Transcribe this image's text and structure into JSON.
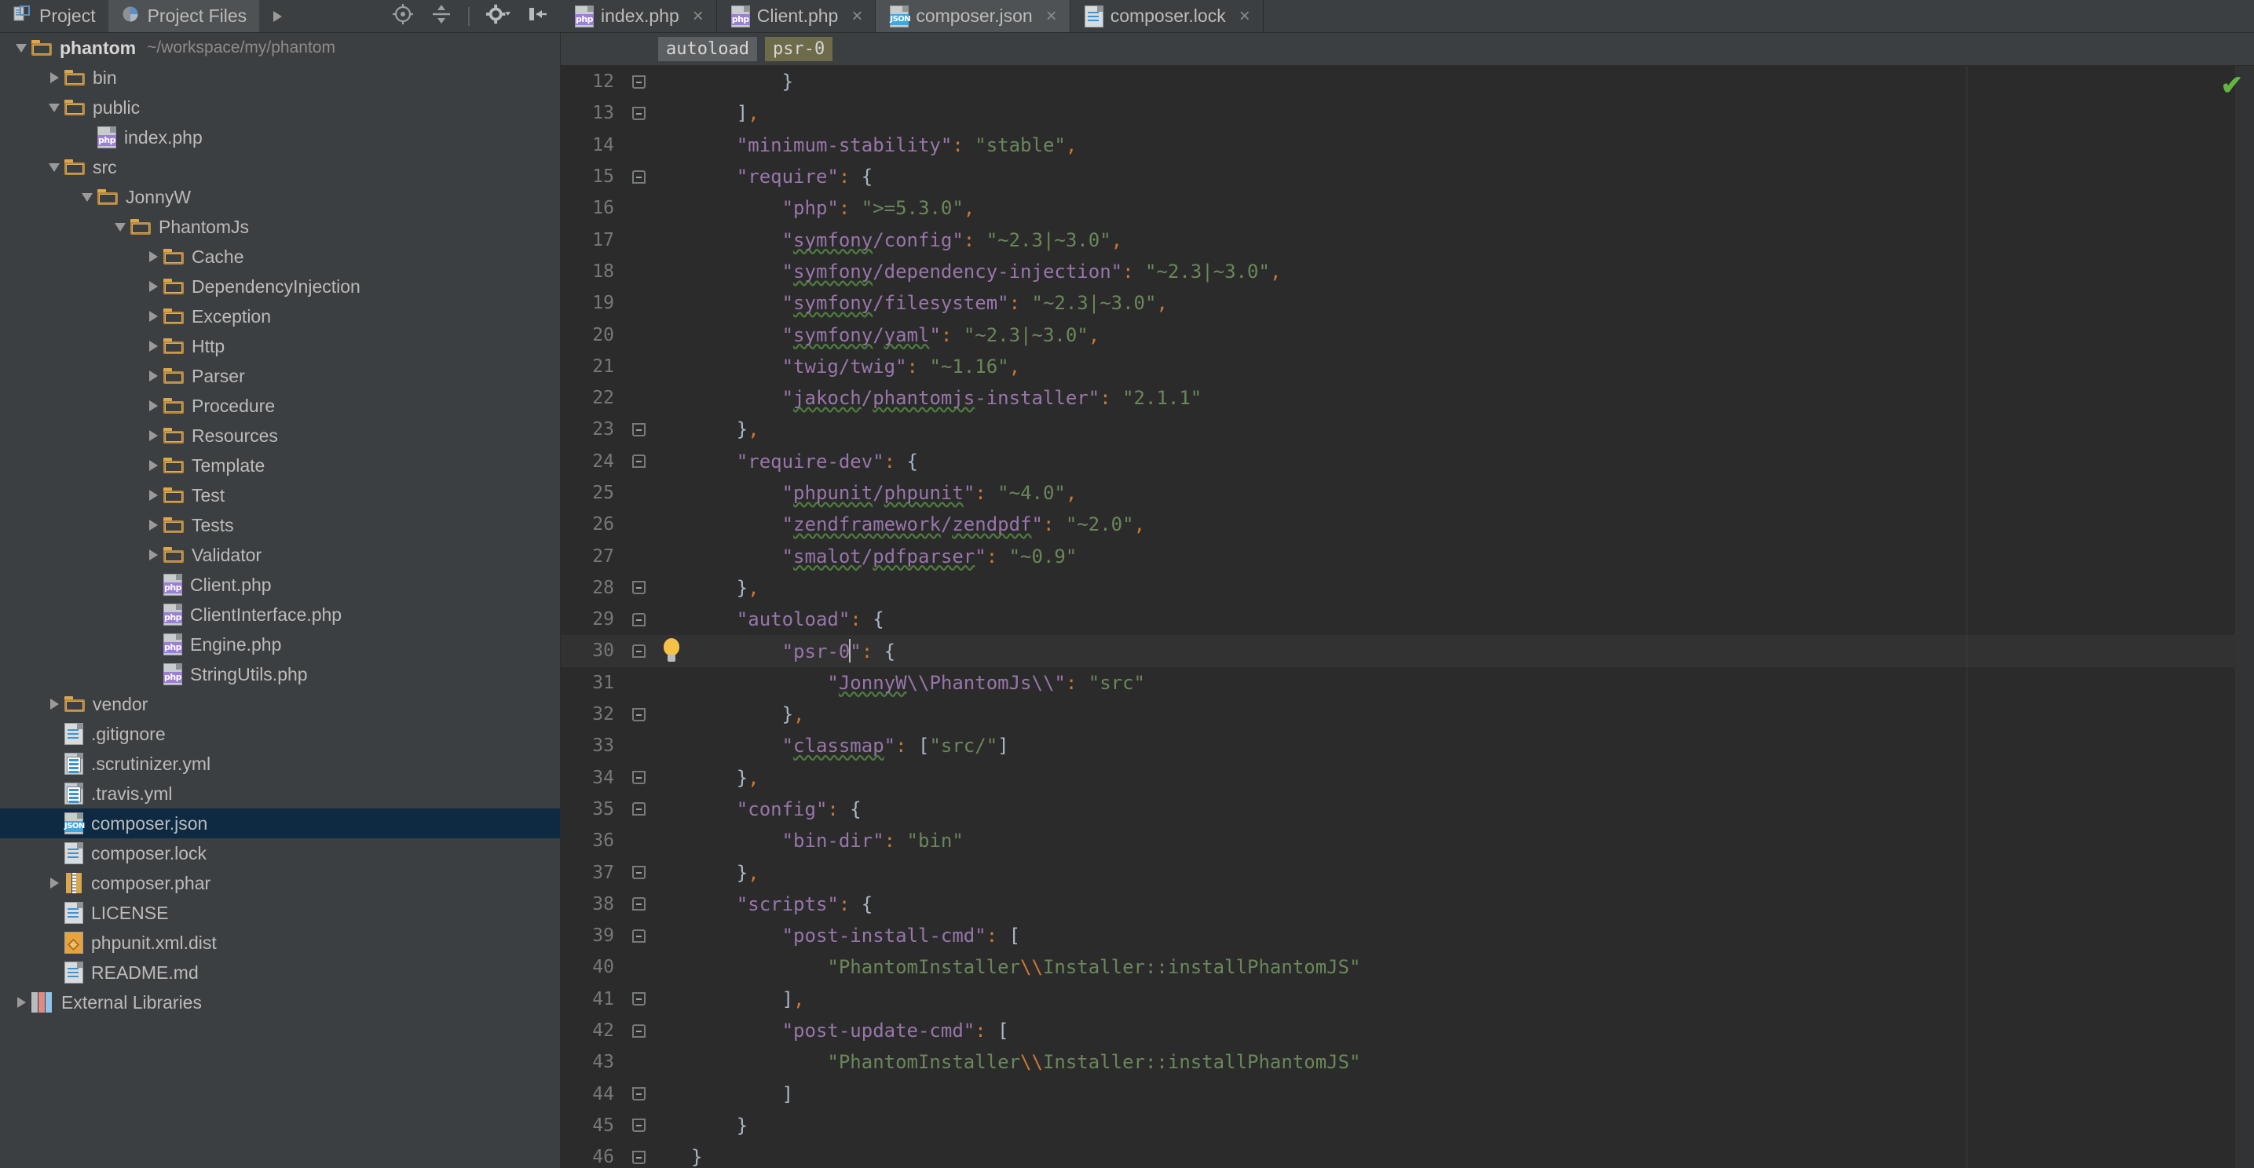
{
  "project_toolbar": {
    "tabs": [
      {
        "label": "Project",
        "icon": "project-icon",
        "selected": false
      },
      {
        "label": "Project Files",
        "icon": "project-files-icon",
        "selected": true
      }
    ],
    "expand_arrow_icon": "chevron-right-icon",
    "icons": [
      {
        "name": "locate-target-icon",
        "glyph": "⊕"
      },
      {
        "name": "collapse-all-icon",
        "glyph": "⫫"
      },
      {
        "name": "settings-gear-icon",
        "glyph": "⚙"
      },
      {
        "name": "hide-panel-icon",
        "glyph": "⇤"
      }
    ]
  },
  "editor_tabs": [
    {
      "label": "index.php",
      "filetype": "php",
      "active": false,
      "close": "×"
    },
    {
      "label": "Client.php",
      "filetype": "php",
      "active": false,
      "close": "×"
    },
    {
      "label": "composer.json",
      "filetype": "json",
      "active": true,
      "close": "×"
    },
    {
      "label": "composer.lock",
      "filetype": "txt",
      "active": false,
      "close": "×"
    }
  ],
  "breadcrumbs": [
    {
      "label": "autoload",
      "style": "c1"
    },
    {
      "label": "psr-0",
      "style": "c2"
    }
  ],
  "tree": [
    {
      "indent": 0,
      "twisty": "down",
      "icon": "folder",
      "name": "phantom",
      "bold": true,
      "path": "~/workspace/my/phantom"
    },
    {
      "indent": 1,
      "twisty": "right",
      "icon": "folder",
      "name": "bin"
    },
    {
      "indent": 1,
      "twisty": "down",
      "icon": "folder",
      "name": "public"
    },
    {
      "indent": 2,
      "twisty": "none",
      "icon": "php",
      "name": "index.php"
    },
    {
      "indent": 1,
      "twisty": "down",
      "icon": "folder",
      "name": "src"
    },
    {
      "indent": 2,
      "twisty": "down",
      "icon": "folder",
      "name": "JonnyW"
    },
    {
      "indent": 3,
      "twisty": "down",
      "icon": "folder",
      "name": "PhantomJs"
    },
    {
      "indent": 4,
      "twisty": "right",
      "icon": "folder",
      "name": "Cache"
    },
    {
      "indent": 4,
      "twisty": "right",
      "icon": "folder",
      "name": "DependencyInjection"
    },
    {
      "indent": 4,
      "twisty": "right",
      "icon": "folder",
      "name": "Exception"
    },
    {
      "indent": 4,
      "twisty": "right",
      "icon": "folder",
      "name": "Http"
    },
    {
      "indent": 4,
      "twisty": "right",
      "icon": "folder",
      "name": "Parser"
    },
    {
      "indent": 4,
      "twisty": "right",
      "icon": "folder",
      "name": "Procedure"
    },
    {
      "indent": 4,
      "twisty": "right",
      "icon": "folder",
      "name": "Resources"
    },
    {
      "indent": 4,
      "twisty": "right",
      "icon": "folder",
      "name": "Template"
    },
    {
      "indent": 4,
      "twisty": "right",
      "icon": "folder",
      "name": "Test"
    },
    {
      "indent": 4,
      "twisty": "right",
      "icon": "folder",
      "name": "Tests"
    },
    {
      "indent": 4,
      "twisty": "right",
      "icon": "folder",
      "name": "Validator"
    },
    {
      "indent": 4,
      "twisty": "none",
      "icon": "php",
      "name": "Client.php"
    },
    {
      "indent": 4,
      "twisty": "none",
      "icon": "php",
      "name": "ClientInterface.php"
    },
    {
      "indent": 4,
      "twisty": "none",
      "icon": "php",
      "name": "Engine.php"
    },
    {
      "indent": 4,
      "twisty": "none",
      "icon": "php",
      "name": "StringUtils.php"
    },
    {
      "indent": 1,
      "twisty": "right",
      "icon": "folder",
      "name": "vendor"
    },
    {
      "indent": 1,
      "twisty": "none",
      "icon": "txt",
      "name": ".gitignore"
    },
    {
      "indent": 1,
      "twisty": "none",
      "icon": "yml",
      "name": ".scrutinizer.yml"
    },
    {
      "indent": 1,
      "twisty": "none",
      "icon": "yml",
      "name": ".travis.yml"
    },
    {
      "indent": 1,
      "twisty": "none",
      "icon": "json",
      "name": "composer.json",
      "selected": true
    },
    {
      "indent": 1,
      "twisty": "none",
      "icon": "txt",
      "name": "composer.lock"
    },
    {
      "indent": 1,
      "twisty": "right",
      "icon": "phar",
      "name": "composer.phar"
    },
    {
      "indent": 1,
      "twisty": "none",
      "icon": "txt",
      "name": "LICENSE"
    },
    {
      "indent": 1,
      "twisty": "none",
      "icon": "xml",
      "name": "phpunit.xml.dist"
    },
    {
      "indent": 1,
      "twisty": "none",
      "icon": "txt",
      "name": "README.md"
    },
    {
      "indent": 0,
      "twisty": "right",
      "icon": "extlib",
      "name": "External Libraries"
    }
  ],
  "code": {
    "first_line": 12,
    "current_line": 30,
    "bulb_line": 30,
    "status_icon": "inspection-ok-checkmark",
    "lines": [
      {
        "n": 12,
        "fold": "close",
        "html": "        <span class=\"b\">}</span>"
      },
      {
        "n": 13,
        "fold": "close",
        "html": "    <span class=\"b\">]</span><span class=\"p\">,</span>"
      },
      {
        "n": 14,
        "fold": "none",
        "html": "    <span class=\"k\">\"minimum-stability\"</span><span class=\"p\">:</span> <span class=\"s\">\"stable\"</span><span class=\"p\">,</span>"
      },
      {
        "n": 15,
        "fold": "open",
        "html": "    <span class=\"k\">\"require\"</span><span class=\"p\">:</span> <span class=\"b\">{</span>"
      },
      {
        "n": 16,
        "fold": "none",
        "html": "        <span class=\"k\">\"php\"</span><span class=\"p\">:</span> <span class=\"s\">\"&gt;=5.3.0\"</span><span class=\"p\">,</span>"
      },
      {
        "n": 17,
        "fold": "none",
        "html": "        <span class=\"k\">\"<span class=\"sp\">symfony</span>/config\"</span><span class=\"p\">:</span> <span class=\"s\">\"~2.3|~3.0\"</span><span class=\"p\">,</span>"
      },
      {
        "n": 18,
        "fold": "none",
        "html": "        <span class=\"k\">\"<span class=\"sp\">symfony</span>/dependency-injection\"</span><span class=\"p\">:</span> <span class=\"s\">\"~2.3|~3.0\"</span><span class=\"p\">,</span>"
      },
      {
        "n": 19,
        "fold": "none",
        "html": "        <span class=\"k\">\"<span class=\"sp\">symfony</span>/filesystem\"</span><span class=\"p\">:</span> <span class=\"s\">\"~2.3|~3.0\"</span><span class=\"p\">,</span>"
      },
      {
        "n": 20,
        "fold": "none",
        "html": "        <span class=\"k\">\"<span class=\"sp\">symfony</span>/<span class=\"sp\">yaml</span>\"</span><span class=\"p\">:</span> <span class=\"s\">\"~2.3|~3.0\"</span><span class=\"p\">,</span>"
      },
      {
        "n": 21,
        "fold": "none",
        "html": "        <span class=\"k\">\"twig/twig\"</span><span class=\"p\">:</span> <span class=\"s\">\"~1.16\"</span><span class=\"p\">,</span>"
      },
      {
        "n": 22,
        "fold": "none",
        "html": "        <span class=\"k\">\"<span class=\"sp\">jakoch</span>/<span class=\"sp\">phantomjs</span>-installer\"</span><span class=\"p\">:</span> <span class=\"s\">\"2.1.1\"</span>"
      },
      {
        "n": 23,
        "fold": "close",
        "html": "    <span class=\"b\">}</span><span class=\"p\">,</span>"
      },
      {
        "n": 24,
        "fold": "open",
        "html": "    <span class=\"k\">\"require-dev\"</span><span class=\"p\">:</span> <span class=\"b\">{</span>"
      },
      {
        "n": 25,
        "fold": "none",
        "html": "        <span class=\"k\">\"<span class=\"sp\">phpunit</span>/<span class=\"sp\">phpunit</span>\"</span><span class=\"p\">:</span> <span class=\"s\">\"~4.0\"</span><span class=\"p\">,</span>"
      },
      {
        "n": 26,
        "fold": "none",
        "html": "        <span class=\"k\">\"<span class=\"sp\">zendframework</span>/<span class=\"sp\">zendpdf</span>\"</span><span class=\"p\">:</span> <span class=\"s\">\"~2.0\"</span><span class=\"p\">,</span>"
      },
      {
        "n": 27,
        "fold": "none",
        "html": "        <span class=\"k\">\"<span class=\"sp\">smalot</span>/<span class=\"sp\">pdfparser</span>\"</span><span class=\"p\">:</span> <span class=\"s\">\"~0.9\"</span>"
      },
      {
        "n": 28,
        "fold": "close",
        "html": "    <span class=\"b\">}</span><span class=\"p\">,</span>"
      },
      {
        "n": 29,
        "fold": "open",
        "html": "    <span class=\"k\">\"autoload\"</span><span class=\"p\">:</span> <span class=\"b\">{</span>"
      },
      {
        "n": 30,
        "fold": "open",
        "bulb": true,
        "current": true,
        "html": "        <span class=\"k\">\"psr-0</span><span class=\"caret\"></span><span class=\"k\">\"</span><span class=\"p\">:</span> <span class=\"b\">{</span>"
      },
      {
        "n": 31,
        "fold": "none",
        "html": "            <span class=\"k\">\"<span class=\"sp\">JonnyW</span>\\\\PhantomJs\\\\\"</span><span class=\"p\">:</span> <span class=\"s\">\"src\"</span>"
      },
      {
        "n": 32,
        "fold": "close",
        "html": "        <span class=\"b\">}</span><span class=\"p\">,</span>"
      },
      {
        "n": 33,
        "fold": "none",
        "html": "        <span class=\"k\">\"<span class=\"sp\">classmap</span>\"</span><span class=\"p\">:</span> <span class=\"b\">[</span><span class=\"s\">\"src/\"</span><span class=\"b\">]</span>"
      },
      {
        "n": 34,
        "fold": "close",
        "html": "    <span class=\"b\">}</span><span class=\"p\">,</span>"
      },
      {
        "n": 35,
        "fold": "open",
        "html": "    <span class=\"k\">\"config\"</span><span class=\"p\">:</span> <span class=\"b\">{</span>"
      },
      {
        "n": 36,
        "fold": "none",
        "html": "        <span class=\"k\">\"bin-dir\"</span><span class=\"p\">:</span> <span class=\"s\">\"bin\"</span>"
      },
      {
        "n": 37,
        "fold": "close",
        "html": "    <span class=\"b\">}</span><span class=\"p\">,</span>"
      },
      {
        "n": 38,
        "fold": "open",
        "html": "    <span class=\"k\">\"scripts\"</span><span class=\"p\">:</span> <span class=\"b\">{</span>"
      },
      {
        "n": 39,
        "fold": "open",
        "html": "        <span class=\"k\">\"post-install-cmd\"</span><span class=\"p\">:</span> <span class=\"b\">[</span>"
      },
      {
        "n": 40,
        "fold": "none",
        "html": "            <span class=\"s\">\"PhantomInstaller<span class=\"esc\">\\\\</span>Installer::installPhantomJS\"</span>"
      },
      {
        "n": 41,
        "fold": "close",
        "html": "        <span class=\"b\">]</span><span class=\"p\">,</span>"
      },
      {
        "n": 42,
        "fold": "open",
        "html": "        <span class=\"k\">\"post-update-cmd\"</span><span class=\"p\">:</span> <span class=\"b\">[</span>"
      },
      {
        "n": 43,
        "fold": "none",
        "html": "            <span class=\"s\">\"PhantomInstaller<span class=\"esc\">\\\\</span>Installer::installPhantomJS\"</span>"
      },
      {
        "n": 44,
        "fold": "close",
        "html": "        <span class=\"b\">]</span>"
      },
      {
        "n": 45,
        "fold": "close",
        "html": "    <span class=\"b\">}</span>"
      },
      {
        "n": 46,
        "fold": "close",
        "html": "<span class=\"b\">}</span>"
      }
    ]
  },
  "colors": {
    "background": "#3c3f41",
    "editor_background": "#2b2b2b",
    "selection": "#0d2a42",
    "key": "#9876aa",
    "string": "#6a8759",
    "punctuation": "#cc7832",
    "text": "#a9b7c6",
    "folder": "#e0b063",
    "ok_green": "#62b543"
  }
}
